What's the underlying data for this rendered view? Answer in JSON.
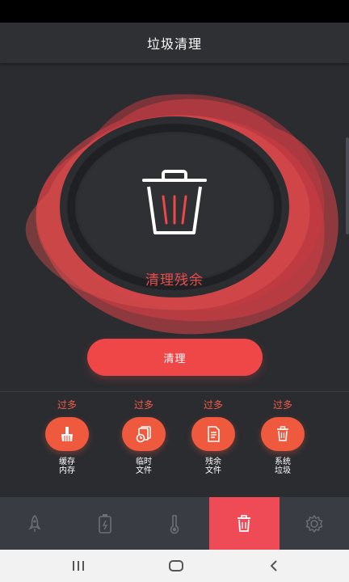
{
  "header": {
    "title": "垃圾清理"
  },
  "hero": {
    "label": "清理残余"
  },
  "clean_button": {
    "label": "清理"
  },
  "categories": [
    {
      "status": "过多",
      "line1": "缓存",
      "line2": "内存",
      "icon": "broom-icon"
    },
    {
      "status": "过多",
      "line1": "临时",
      "line2": "文件",
      "icon": "temp-files-icon"
    },
    {
      "status": "过多",
      "line1": "残余",
      "line2": "文件",
      "icon": "document-icon"
    },
    {
      "status": "过多",
      "line1": "系统",
      "line2": "垃圾",
      "icon": "trash-icon"
    }
  ],
  "bottom_nav": [
    {
      "name": "rocket-icon",
      "active": false
    },
    {
      "name": "battery-icon",
      "active": false
    },
    {
      "name": "thermometer-icon",
      "active": false
    },
    {
      "name": "trash-icon",
      "active": true
    },
    {
      "name": "gear-icon",
      "active": false
    }
  ],
  "system_nav": [
    "recent-apps-icon",
    "home-icon",
    "back-icon"
  ],
  "colors": {
    "accent": "#ef4747",
    "background": "#2b2c30",
    "nav_active": "#ef4b56",
    "category_circle": "#ef5a3e"
  }
}
